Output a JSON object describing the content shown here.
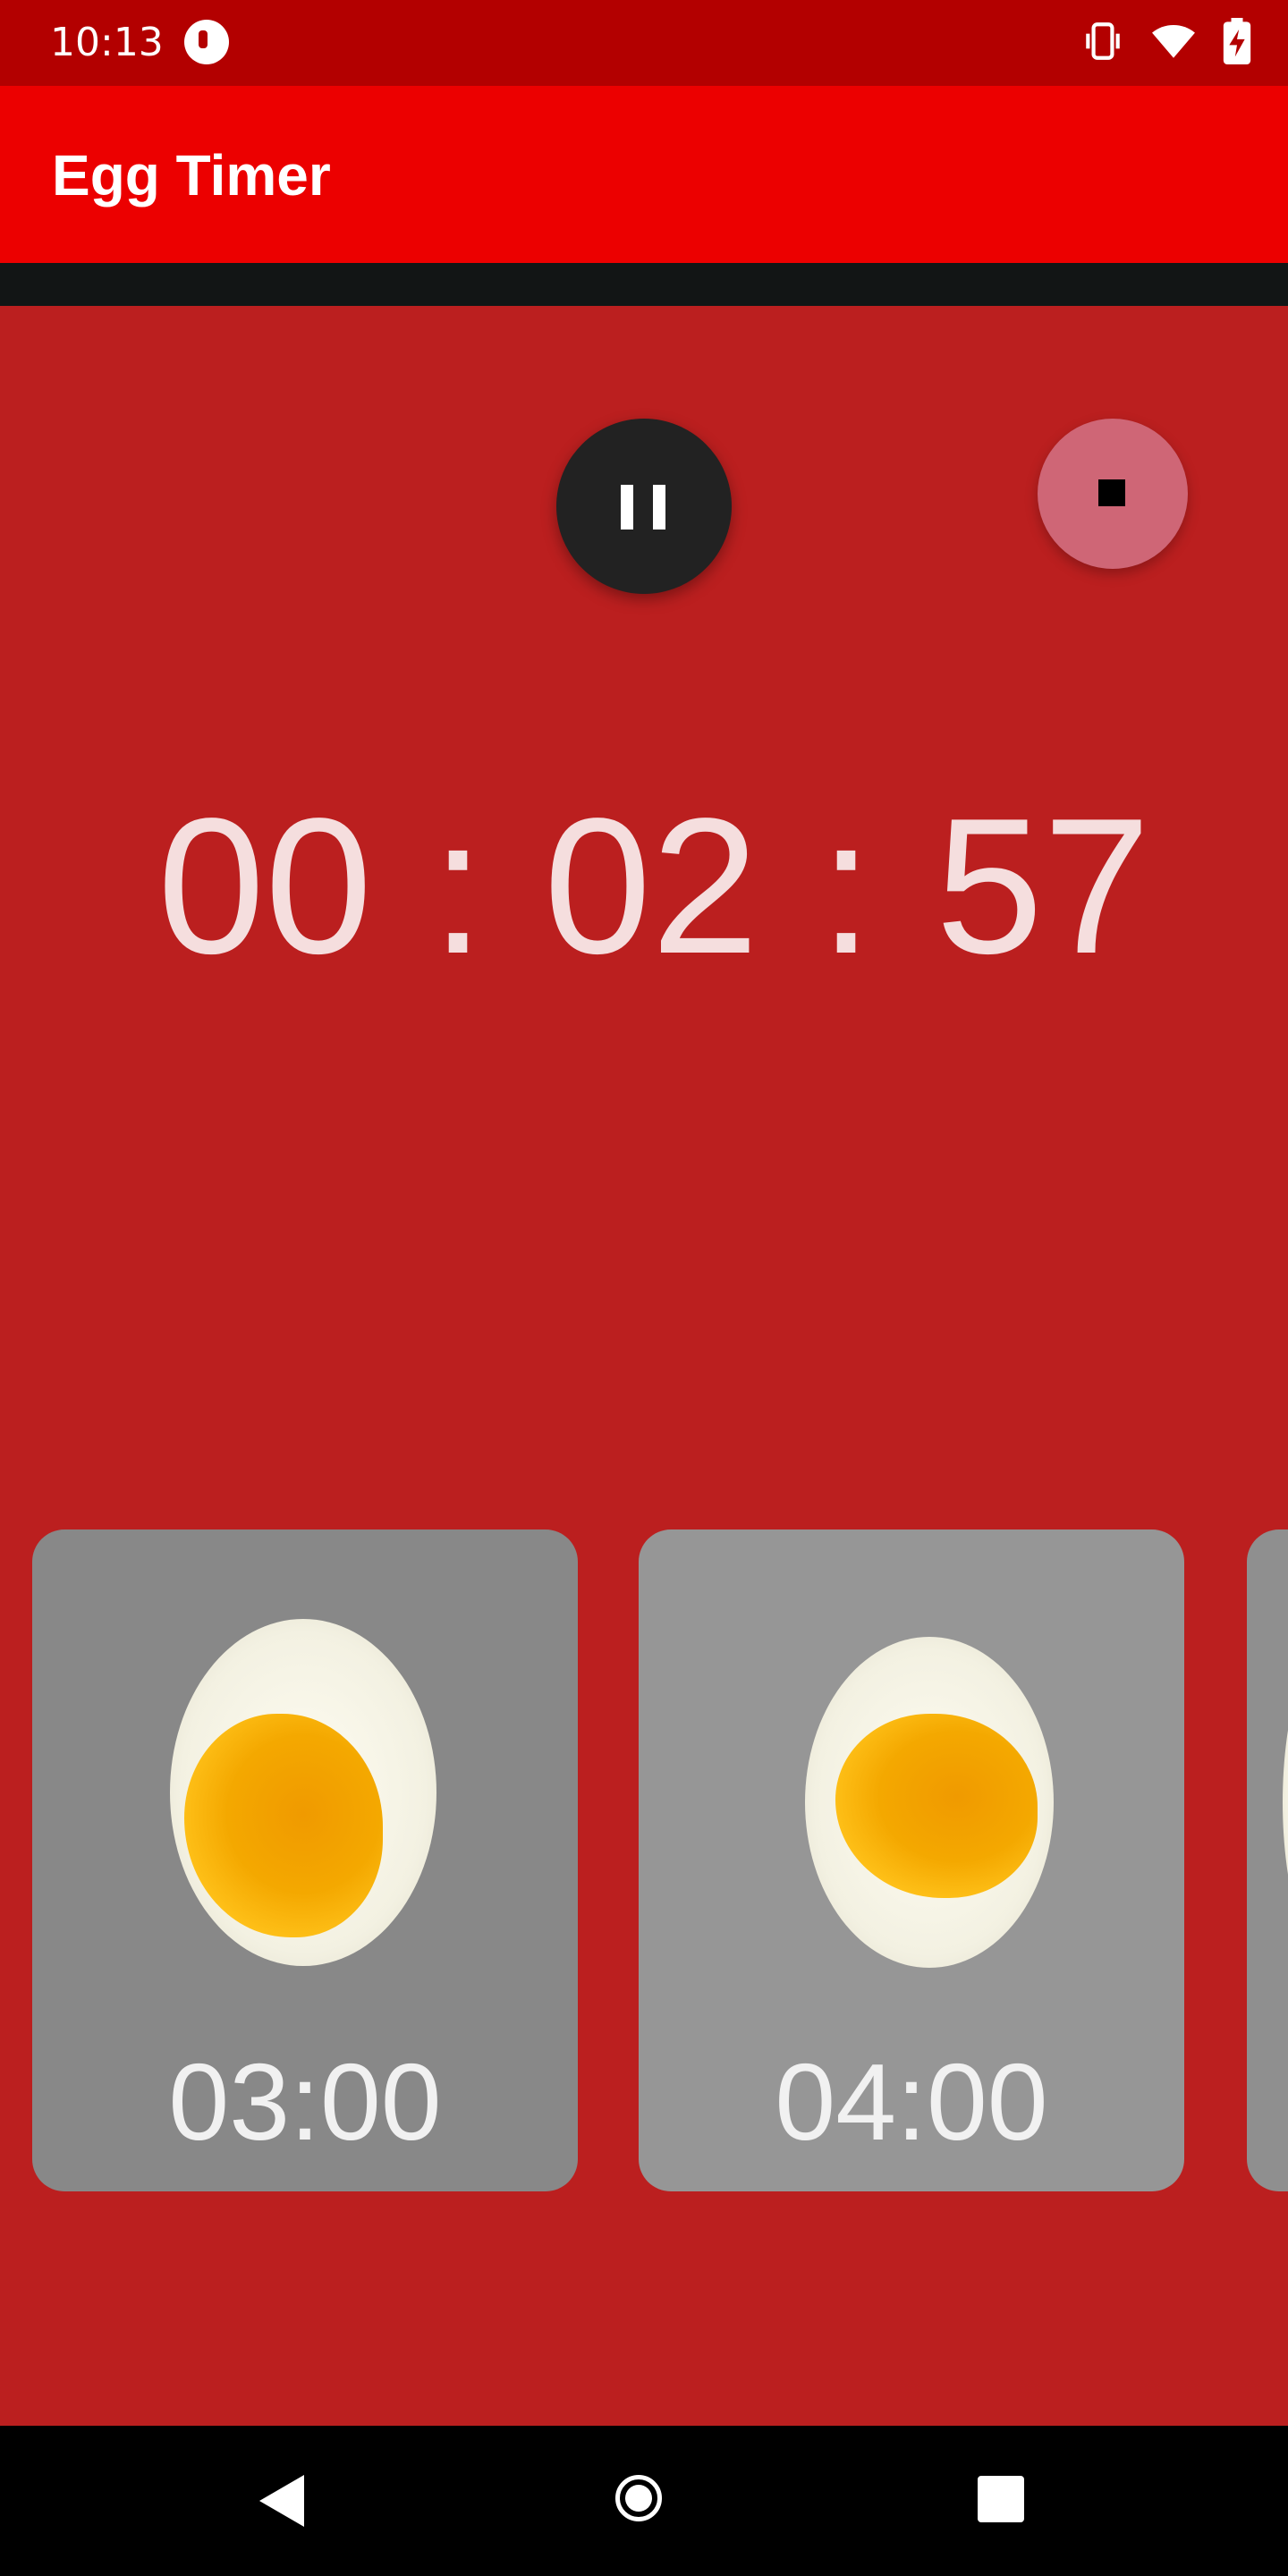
{
  "status_bar": {
    "time": "10:13",
    "icons": [
      "notification-icon",
      "vibrate-icon",
      "wifi-icon",
      "battery-charging-icon"
    ]
  },
  "app_bar": {
    "title": "Egg Timer"
  },
  "controls": {
    "pause_icon": "pause-icon",
    "stop_icon": "stop-icon"
  },
  "timer": {
    "hours": "00",
    "minutes": "02",
    "seconds": "57",
    "separator": ":"
  },
  "presets": [
    {
      "label": "03:00",
      "image": "soft-boiled-egg"
    },
    {
      "label": "04:00",
      "image": "medium-boiled-egg"
    }
  ],
  "navigation": {
    "icons": [
      "back-icon",
      "home-icon",
      "recents-icon"
    ]
  },
  "colors": {
    "status_bar": "#b30000",
    "app_bar": "#ec0000",
    "background": "#bb1f1f",
    "pause_button": "#222222",
    "stop_button": "#cf6676",
    "card_1": "#888888",
    "card_2": "#969696"
  }
}
